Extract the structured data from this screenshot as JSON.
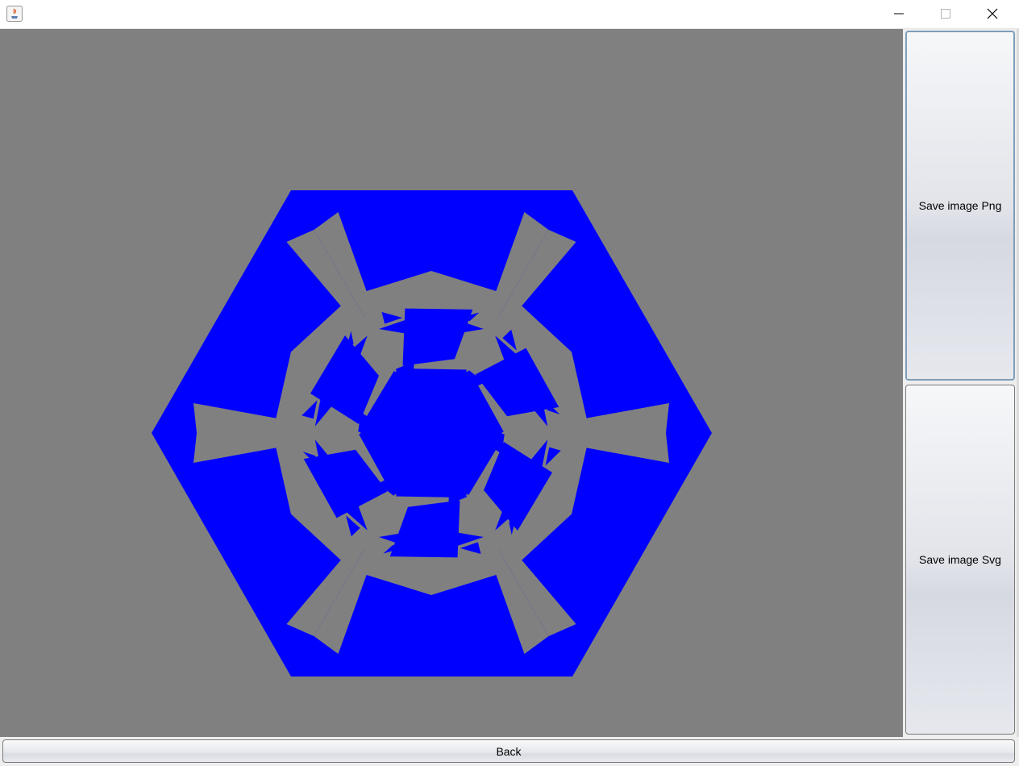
{
  "window": {
    "title": "",
    "controls": [
      "minimize-icon",
      "maximize-icon",
      "close-icon"
    ]
  },
  "canvas": {
    "background": "#808080",
    "shape_color": "#0000ff"
  },
  "buttons": {
    "save_png": "Save image Png",
    "save_svg": "Save image Svg",
    "back": "Back"
  }
}
